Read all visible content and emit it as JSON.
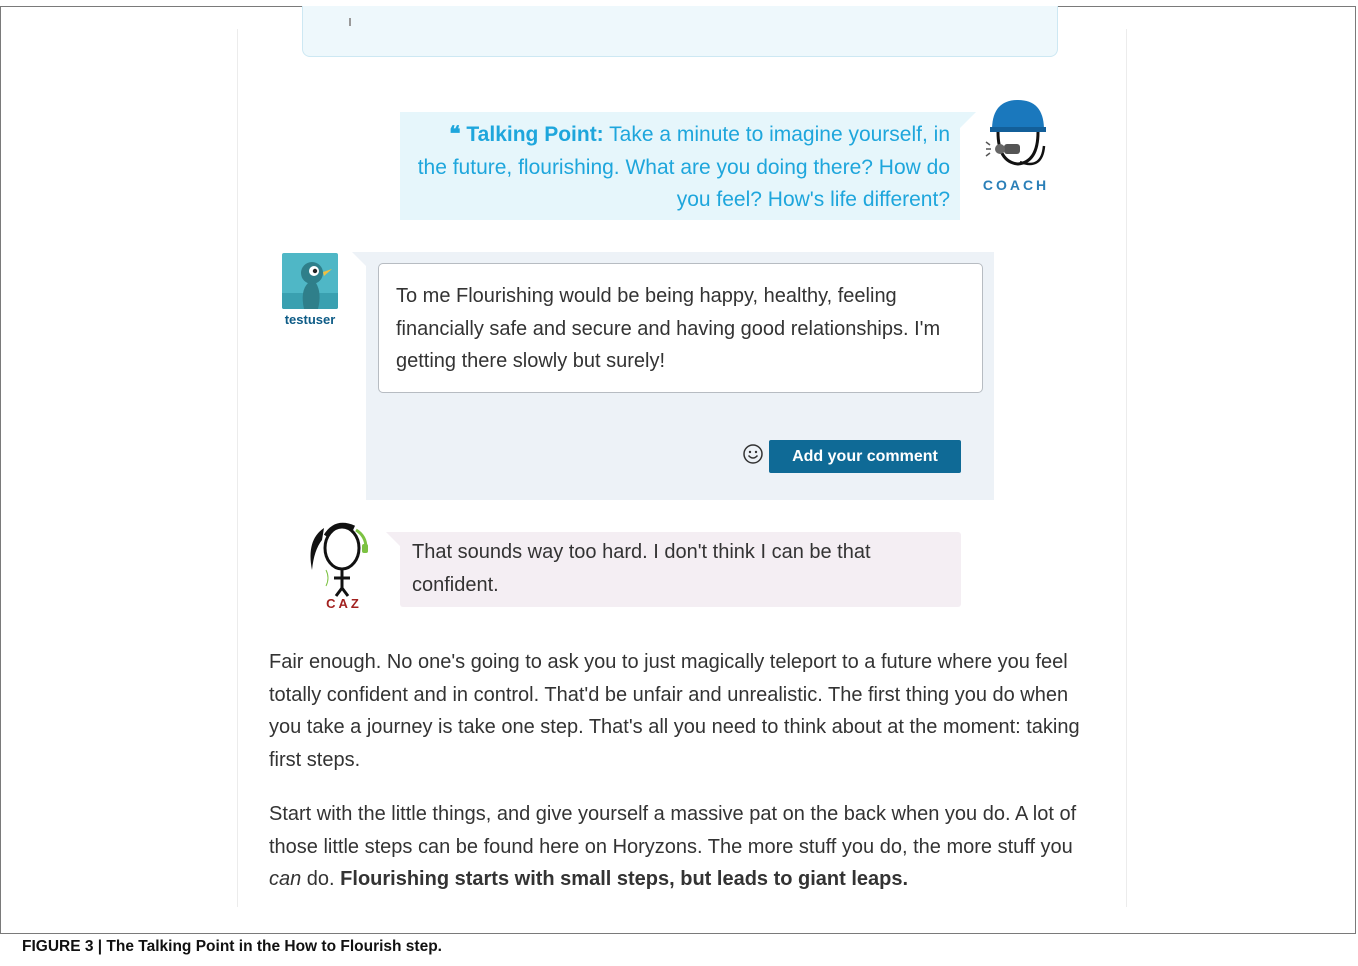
{
  "coach_message": {
    "label": "Talking Point:",
    "text": "Take a minute to imagine yourself, in the future, flourishing. What are you doing there? How do you feel? How's life different?",
    "avatar_name": "COACH"
  },
  "user_post": {
    "username": "testuser",
    "comment_text": "To me Flourishing would be being happy, healthy, feeling financially safe and secure and having good relationships. I'm getting there slowly but surely!",
    "submit_label": "Add your comment"
  },
  "caz_message": {
    "avatar_name": "CAZ",
    "text": "That sounds way too hard. I don't think I can be that confident."
  },
  "body": {
    "paragraph1": "Fair enough. No one's going to ask you to just magically teleport to a future where you feel totally confident and in control. That'd be unfair and unrealistic. The first thing you do when you take a journey is take one step. That's all you need to think about at the moment: taking first steps.",
    "paragraph2_start": "Start with the little things, and give yourself a massive pat on the back when you do. A lot of those little steps can be found here on Horyzons. The more stuff you do, the more stuff you ",
    "paragraph2_em": "can",
    "paragraph2_mid": " do. ",
    "paragraph2_bold": "Flourishing starts with small steps, but leads to giant leaps."
  },
  "caption": "FIGURE 3 | The Talking Point in the How to Flourish step.",
  "colors": {
    "coach_text": "#1ea6dc",
    "coach_bubble": "#e6f6fb",
    "user_panel": "#edf2f7",
    "caz_bubble": "#f4eef3",
    "button": "#0f6a96",
    "caz_label": "#a2211f"
  },
  "icons": {
    "quote": "quote-icon",
    "coach_avatar": "coach-whistle-icon",
    "user_avatar": "bird-avatar-icon",
    "smiley": "smiley-icon",
    "caz_avatar": "caz-character-icon"
  }
}
